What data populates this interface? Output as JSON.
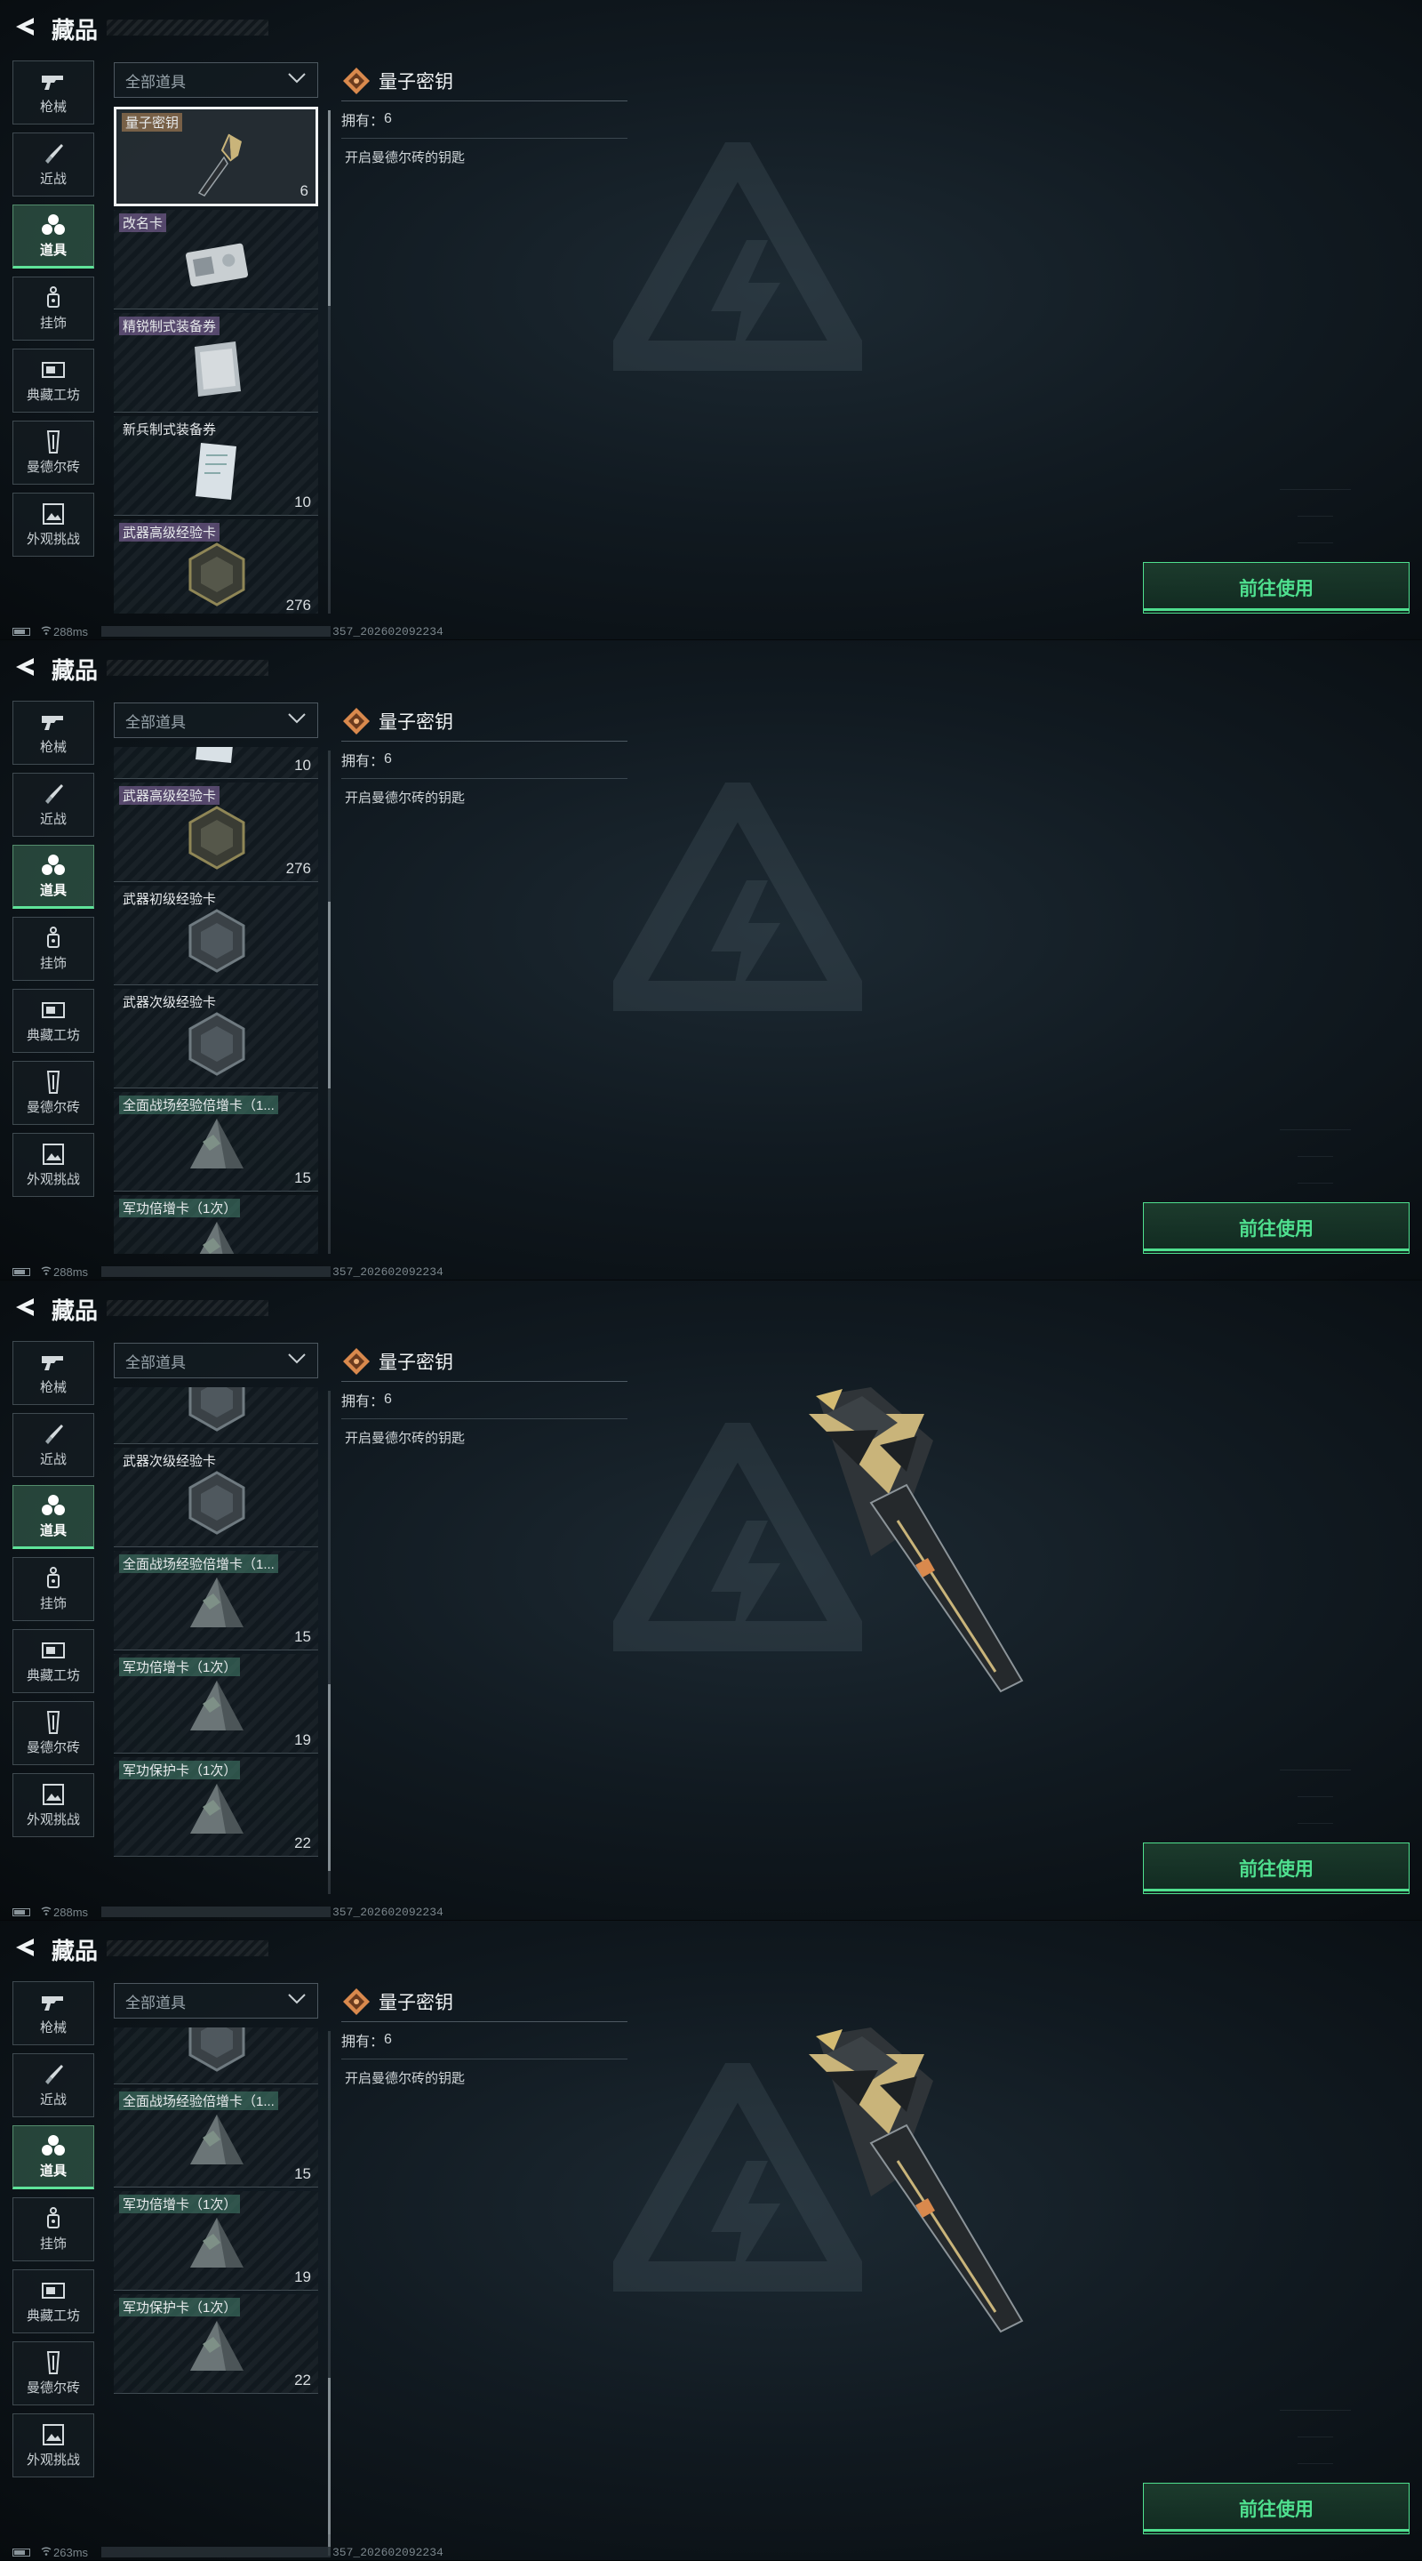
{
  "header": {
    "title": "藏品"
  },
  "nav": [
    {
      "key": "guns",
      "label": "枪械",
      "icon": "gun-icon"
    },
    {
      "key": "melee",
      "label": "近战",
      "icon": "knife-icon"
    },
    {
      "key": "items",
      "label": "道具",
      "icon": "items-icon",
      "active": true
    },
    {
      "key": "charms",
      "label": "挂饰",
      "icon": "charm-icon"
    },
    {
      "key": "workshop",
      "label": "典藏工坊",
      "icon": "workshop-icon"
    },
    {
      "key": "mandel",
      "label": "曼德尔砖",
      "icon": "brick-icon"
    },
    {
      "key": "appearance",
      "label": "外观挑战",
      "icon": "appearance-icon"
    }
  ],
  "filter": {
    "label": "全部道具"
  },
  "items": [
    {
      "name": "量子密钥",
      "count": "6",
      "tag": "gold",
      "thumb": "key"
    },
    {
      "name": "改名卡",
      "count": "",
      "tag": "purple",
      "thumb": "card"
    },
    {
      "name": "精锐制式装备券",
      "count": "",
      "tag": "purple",
      "thumb": "ticket"
    },
    {
      "name": "新兵制式装备券",
      "count": "10",
      "tag": "none",
      "thumb": "paper"
    },
    {
      "name": "武器高级经验卡",
      "count": "276",
      "tag": "purple",
      "thumb": "hex-gold"
    },
    {
      "name": "武器初级经验卡",
      "count": "",
      "tag": "none",
      "thumb": "hex"
    },
    {
      "name": "武器次级经验卡",
      "count": "",
      "tag": "none",
      "thumb": "hex"
    },
    {
      "name": "全面战场经验倍增卡（1...",
      "count": "15",
      "tag": "green",
      "thumb": "pyramid"
    },
    {
      "name": "军功倍增卡（1次）",
      "count": "19",
      "tag": "green",
      "thumb": "pyramid"
    },
    {
      "name": "军功保护卡（1次）",
      "count": "22",
      "tag": "green",
      "thumb": "pyramid"
    }
  ],
  "detail": {
    "title": "量子密钥",
    "owned_label": "拥有：",
    "owned_value": "6",
    "description": "开启曼德尔砖的钥匙",
    "button_label": "前往使用"
  },
  "frames": [
    {
      "ping": "288ms",
      "build": "357_202602092234",
      "show_render": false
    },
    {
      "ping": "288ms",
      "build": "357_202602092234",
      "show_render": false
    },
    {
      "ping": "288ms",
      "build": "357_202602092234",
      "show_render": true
    },
    {
      "ping": "263ms",
      "build": "357_202602092234",
      "show_render": true
    }
  ],
  "colors": {
    "accent": "#4fe08f",
    "selected_border": "#f0f2f3"
  }
}
